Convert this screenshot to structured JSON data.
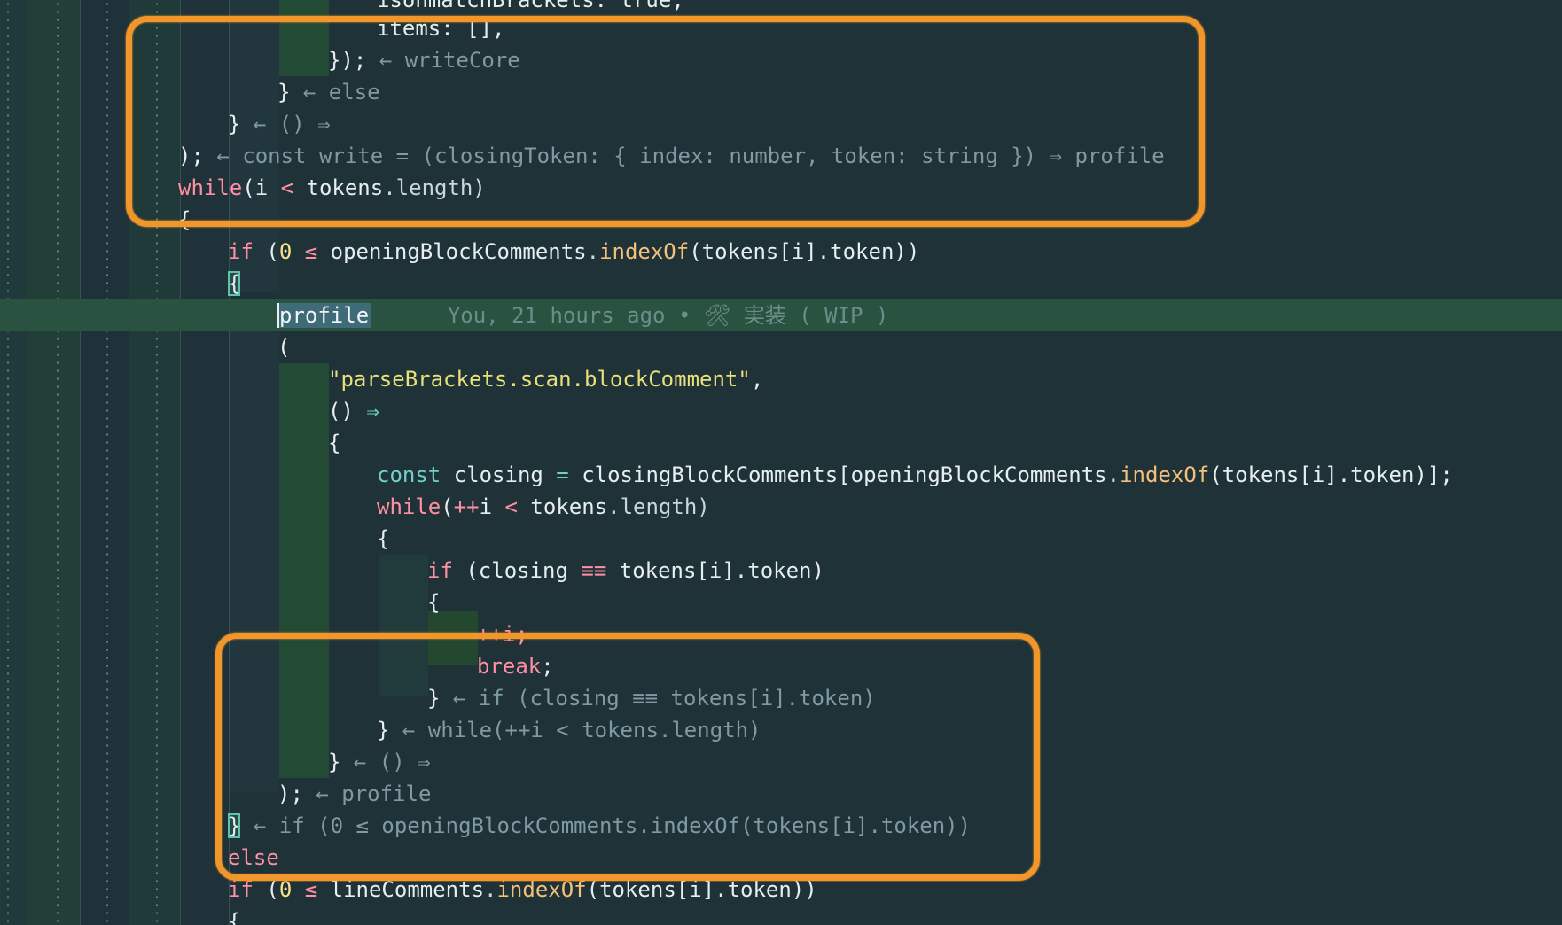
{
  "colors": {
    "background": "#1f3238",
    "current_line": "#2a5240",
    "keyword": "#ff8fa3",
    "function": "#f5c07a",
    "string": "#e8e07a",
    "number": "#f7e28a",
    "comment_hint": "#7f9aa2",
    "annotation": "#f0962a"
  },
  "code": {
    "l0_text": "isUnmatchBrackets: true,",
    "l1_text": "items: [],",
    "l2_close": "});",
    "l2_hint": "← writeCore",
    "l3_close": "}",
    "l3_hint": "← else",
    "l4_close": "}",
    "l4_hint": "← () ⇒",
    "l5_close": ");",
    "l5_hint": "← const write = (closingToken: { index: number, token: string }) ⇒ profile",
    "l6_kw": "while",
    "l6_a": "(i ",
    "l6_op": "<",
    "l6_b": " tokens",
    "l6_c": ".length)",
    "l7_text": "{",
    "l8_kw": "if",
    "l8_a": " (",
    "l8_num": "0",
    "l8_op": " ≤ ",
    "l8_b": "openingBlockComments",
    "l8_c": ".",
    "l8_fn": "indexOf",
    "l8_d": "(tokens[i].token))",
    "l9_text": "{",
    "l10_word": "profile",
    "l10_blame": "You, 21 hours ago • 🛠 実装 ( WIP )",
    "l11_text": "(",
    "l12_str": "\"parseBrackets.scan.blockComment\"",
    "l12_b": ",",
    "l13_a": "() ",
    "l13_arrow": "⇒",
    "l14_text": "{",
    "l15_kw": "const",
    "l15_a": " closing ",
    "l15_op": "=",
    "l15_b": " closingBlockComments[openingBlockComments",
    "l15_dot": ".",
    "l15_fn": "indexOf",
    "l15_c": "(tokens[i].token)];",
    "l16_kw": "while",
    "l16_a": "(",
    "l16_op": "++",
    "l16_b": "i ",
    "l16_lt": "<",
    "l16_c": " tokens",
    "l16_d": ".length)",
    "l17_text": "{",
    "l18_kw": "if",
    "l18_a": " (closing ",
    "l18_op": "≡≡",
    "l18_b": " tokens[i].token)",
    "l19_text": "{",
    "l20_text": "++i;",
    "l21_kw": "break",
    "l21_b": ";",
    "l22_close": "}",
    "l22_hint": "← if (closing ≡≡ tokens[i].token)",
    "l23_close": "}",
    "l23_hint": "← while(++i < tokens.length)",
    "l24_close": "}",
    "l24_hint": "← () ⇒",
    "l25_close": ");",
    "l25_hint": "← profile",
    "l26_close": "}",
    "l26_hint": "← if (0 ≤ openingBlockComments.indexOf(tokens[i].token))",
    "l27_kw": "else",
    "l28_kw": "if",
    "l28_a": " (",
    "l28_num": "0",
    "l28_op": " ≤ ",
    "l28_b": "lineComments",
    "l28_c": ".",
    "l28_fn": "indexOf",
    "l28_d": "(tokens[i].token))",
    "l29_text": "{"
  }
}
